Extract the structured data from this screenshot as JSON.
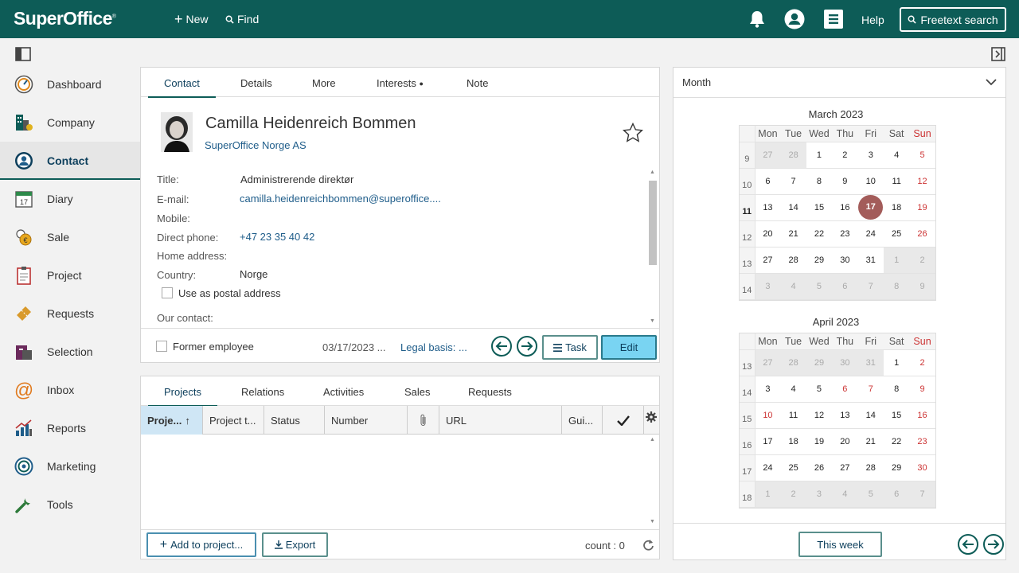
{
  "topbar": {
    "logo": "SuperOffice",
    "logo_mark": "®",
    "new_label": "New",
    "find_label": "Find",
    "help_label": "Help",
    "freetext_label": "Freetext search"
  },
  "sidebar": {
    "items": [
      {
        "label": "Dashboard",
        "icon": "dashboard-icon"
      },
      {
        "label": "Company",
        "icon": "company-icon"
      },
      {
        "label": "Contact",
        "icon": "contact-icon",
        "active": true
      },
      {
        "label": "Diary",
        "icon": "diary-icon"
      },
      {
        "label": "Sale",
        "icon": "sale-icon"
      },
      {
        "label": "Project",
        "icon": "project-icon"
      },
      {
        "label": "Requests",
        "icon": "requests-icon"
      },
      {
        "label": "Selection",
        "icon": "selection-icon"
      },
      {
        "label": "Inbox",
        "icon": "inbox-icon"
      },
      {
        "label": "Reports",
        "icon": "reports-icon"
      },
      {
        "label": "Marketing",
        "icon": "marketing-icon"
      },
      {
        "label": "Tools",
        "icon": "tools-icon"
      }
    ]
  },
  "contact": {
    "tabs": [
      "Contact",
      "Details",
      "More",
      "Interests",
      "Note"
    ],
    "interests_dot": "●",
    "name": "Camilla Heidenreich Bommen",
    "company": "SuperOffice Norge AS",
    "fields": {
      "title_label": "Title:",
      "title_value": "Administrerende direktør",
      "email_label": "E-mail:",
      "email_value": "camilla.heidenreichbommen@superoffice....",
      "mobile_label": "Mobile:",
      "direct_label": "Direct phone:",
      "direct_value": "+47 23 35 40 42",
      "home_label": "Home address:",
      "country_label": "Country:",
      "country_value": "Norge",
      "postal_label": "Use as postal address",
      "our_contact_label": "Our contact:"
    },
    "footer": {
      "former_label": "Former employee",
      "date": "03/17/2023 ...",
      "legal": "Legal basis: ...",
      "task_label": "Task",
      "edit_label": "Edit"
    }
  },
  "bottom": {
    "tabs": [
      "Projects",
      "Relations",
      "Activities",
      "Sales",
      "Requests"
    ],
    "columns": [
      "Proje...",
      "Project t...",
      "Status",
      "Number",
      "",
      "URL",
      "Gui..."
    ],
    "sort_arrow": "↑",
    "add_label": "Add to project...",
    "export_label": "Export",
    "count_label": "count : 0"
  },
  "calendar": {
    "view_label": "Month",
    "days": [
      "Mon",
      "Tue",
      "Wed",
      "Thu",
      "Fri",
      "Sat",
      "Sun"
    ],
    "months": [
      {
        "title": "March 2023",
        "weeks": [
          {
            "wk": "9",
            "days": [
              "27",
              "28",
              "1",
              "2",
              "3",
              "4",
              "5"
            ],
            "other": [
              0,
              1
            ]
          },
          {
            "wk": "10",
            "days": [
              "6",
              "7",
              "8",
              "9",
              "10",
              "11",
              "12"
            ],
            "other": []
          },
          {
            "wk": "11",
            "days": [
              "13",
              "14",
              "15",
              "16",
              "17",
              "18",
              "19"
            ],
            "other": [],
            "today": 4,
            "current": true
          },
          {
            "wk": "12",
            "days": [
              "20",
              "21",
              "22",
              "23",
              "24",
              "25",
              "26"
            ],
            "other": []
          },
          {
            "wk": "13",
            "days": [
              "27",
              "28",
              "29",
              "30",
              "31",
              "1",
              "2"
            ],
            "other": [
              5,
              6
            ]
          },
          {
            "wk": "14",
            "days": [
              "3",
              "4",
              "5",
              "6",
              "7",
              "8",
              "9"
            ],
            "other": [
              0,
              1,
              2,
              3,
              4,
              5,
              6
            ]
          }
        ]
      },
      {
        "title": "April 2023",
        "weeks": [
          {
            "wk": "13",
            "days": [
              "27",
              "28",
              "29",
              "30",
              "31",
              "1",
              "2"
            ],
            "other": [
              0,
              1,
              2,
              3,
              4
            ]
          },
          {
            "wk": "14",
            "days": [
              "3",
              "4",
              "5",
              "6",
              "7",
              "8",
              "9"
            ],
            "other": [],
            "red": [
              3,
              4
            ]
          },
          {
            "wk": "15",
            "days": [
              "10",
              "11",
              "12",
              "13",
              "14",
              "15",
              "16"
            ],
            "other": [],
            "red": [
              0
            ]
          },
          {
            "wk": "16",
            "days": [
              "17",
              "18",
              "19",
              "20",
              "21",
              "22",
              "23"
            ],
            "other": []
          },
          {
            "wk": "17",
            "days": [
              "24",
              "25",
              "26",
              "27",
              "28",
              "29",
              "30"
            ],
            "other": []
          },
          {
            "wk": "18",
            "days": [
              "1",
              "2",
              "3",
              "4",
              "5",
              "6",
              "7"
            ],
            "other": [
              0,
              1,
              2,
              3,
              4,
              5,
              6
            ]
          }
        ]
      }
    ],
    "this_week_label": "This week"
  }
}
